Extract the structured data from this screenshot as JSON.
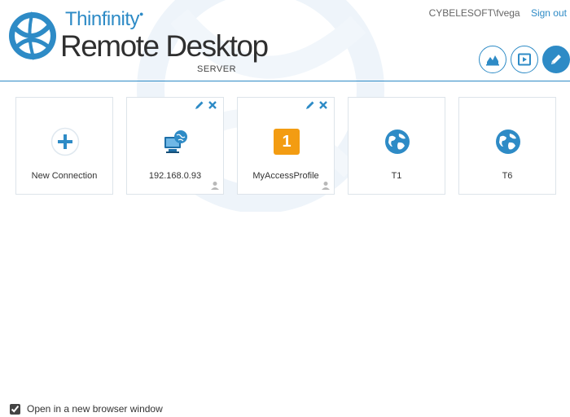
{
  "brand": {
    "company": "Thinfinity",
    "product": "Remote Desktop",
    "edition": "SERVER",
    "accent_color": "#2e8bc6"
  },
  "user_bar": {
    "username": "CYBELESOFT\\fvega",
    "sign_out": "Sign out"
  },
  "toolbar": [
    {
      "icon": "analytics-chart-icon",
      "active": false
    },
    {
      "icon": "play-screen-icon",
      "active": false
    },
    {
      "icon": "pencil-edit-icon",
      "active": true
    }
  ],
  "tiles": [
    {
      "label": "New Connection",
      "icon": "plus-circle-icon",
      "editable": false,
      "shared_user": false
    },
    {
      "label": "192.168.0.93",
      "icon": "computer-globe-icon",
      "editable": true,
      "shared_user": true
    },
    {
      "label": "MyAccessProfile",
      "icon": "number-one-badge-icon",
      "badge_text": "1",
      "badge_color": "#f39c12",
      "editable": true,
      "shared_user": true
    },
    {
      "label": "T1",
      "icon": "globe-icon",
      "editable": false,
      "shared_user": false
    },
    {
      "label": "T6",
      "icon": "globe-icon",
      "editable": false,
      "shared_user": false
    }
  ],
  "footer": {
    "open_new_window_label": "Open in a new browser window",
    "open_new_window_checked": true
  }
}
